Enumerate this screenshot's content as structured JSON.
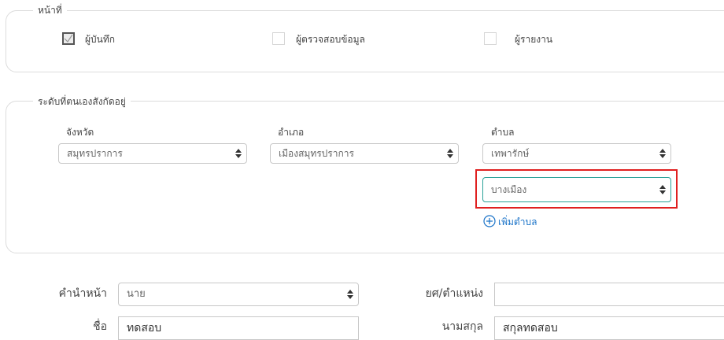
{
  "roles": {
    "legend": "หน้าที่",
    "recorder": {
      "label": "ผู้บันทึก",
      "checked": true
    },
    "checker": {
      "label": "ผู้ตรวจสอบข้อมูล",
      "checked": false
    },
    "reporter": {
      "label": "ผู้รายงาน",
      "checked": false
    }
  },
  "affiliation": {
    "legend": "ระดับที่ตนเองสังกัดอยู่",
    "province_label": "จังหวัด",
    "province_value": "สมุทรปราการ",
    "district_label": "อำเภอ",
    "district_value": "เมืองสมุทรปราการ",
    "subdistrict_label": "ตำบล",
    "subdistrict_value": "เทพารักษ์",
    "subdistrict2_value": "บางเมือง",
    "add_subdistrict": "เพิ่มตำบล"
  },
  "person": {
    "prefix_label": "คำนำหน้า",
    "prefix_value": "นาย",
    "rank_label": "ยศ/ตำแหน่ง",
    "rank_value": "",
    "firstname_label": "ชื่อ",
    "firstname_value": "ทดสอบ",
    "lastname_label": "นามสกุล",
    "lastname_value": "สกุลทดสอบ"
  },
  "colors": {
    "accent": "#2aa198",
    "highlight": "#e02020",
    "link": "#1a73c8"
  }
}
